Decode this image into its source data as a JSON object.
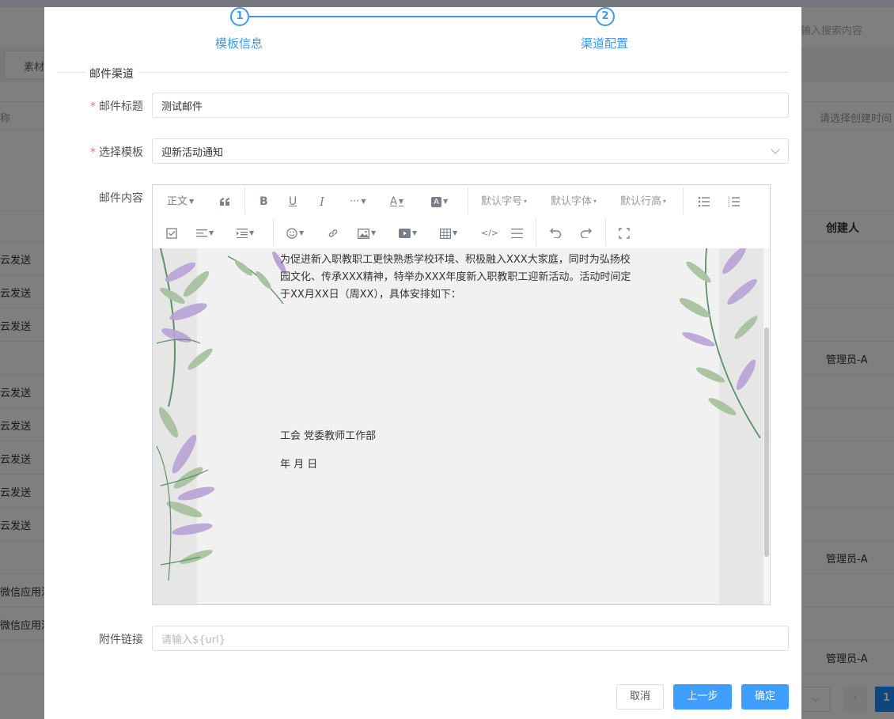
{
  "background": {
    "search_placeholder": "输入搜索内容",
    "tab_label": "素材",
    "column_name": "称",
    "column_time": "请选择创建时间",
    "column_creator": "创建人",
    "rows": [
      {
        "left": "云发送",
        "right": ""
      },
      {
        "left": "云发送",
        "right": ""
      },
      {
        "left": "云发送",
        "right": ""
      },
      {
        "left": "",
        "right": "管理员-A"
      },
      {
        "left": "云发送",
        "right": ""
      },
      {
        "left": "云发送",
        "right": ""
      },
      {
        "left": "云发送",
        "right": ""
      },
      {
        "left": "云发送",
        "right": ""
      },
      {
        "left": "云发送",
        "right": ""
      },
      {
        "left": "",
        "right": "管理员-A"
      },
      {
        "left": "微信应用消",
        "right": ""
      },
      {
        "left": "微信应用消",
        "right": ""
      },
      {
        "left": "",
        "right": "管理员-A"
      }
    ],
    "pager_current": "1"
  },
  "steps": [
    {
      "number": "1",
      "label": "模板信息"
    },
    {
      "number": "2",
      "label": "渠道配置"
    }
  ],
  "section_title": "邮件渠道",
  "form": {
    "subject_label": "邮件标题",
    "subject_value": "测试邮件",
    "template_label": "选择模板",
    "template_value": "迎新活动通知",
    "content_label": "邮件内容",
    "attachment_label": "附件链接",
    "attachment_placeholder": "请输入${url}"
  },
  "editor": {
    "toolbar": {
      "paragraph": "正文",
      "font_size": "默认字号",
      "font_family": "默认字体",
      "line_height": "默认行高"
    },
    "icons": [
      "quote-icon",
      "bold-icon",
      "underline-icon",
      "italic-icon",
      "more-icon",
      "font-color-icon",
      "background-color-icon",
      "bulleted-list-icon",
      "numbered-list-icon",
      "todo-icon",
      "align-icon",
      "indent-icon",
      "emoji-icon",
      "link-icon",
      "image-icon",
      "video-icon",
      "table-icon",
      "code-icon",
      "divider-icon",
      "undo-icon",
      "redo-icon",
      "fullscreen-icon"
    ],
    "content_paragraph": "为促进新入职教职工更快熟悉学校环境、积极融入XXX大家庭，同时为弘扬校园文化、传承XXX精神，特举办XXX年度新入职教职工迎新活动。活动时间定于XX月XX日（周XX），具体安排如下：",
    "signature": "工会   党委教师工作部",
    "date_line": "年 月 日"
  },
  "buttons": {
    "cancel": "取消",
    "prev": "上一步",
    "confirm": "确定"
  },
  "colors": {
    "primary": "#409eff",
    "step": "#3d9aef",
    "required": "#f56c6c"
  }
}
